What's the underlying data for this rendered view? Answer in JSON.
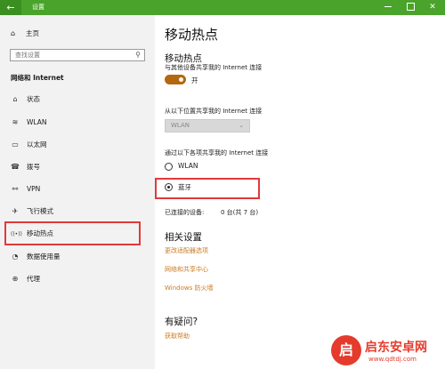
{
  "titlebar": {
    "title": "设置",
    "back_icon": "←",
    "close_icon": "✕"
  },
  "sidebar": {
    "home_label": "主页",
    "search_placeholder": "查找设置",
    "section_title": "网络和 Internet",
    "items": [
      {
        "label": "状态",
        "icon": "⌂"
      },
      {
        "label": "WLAN",
        "icon": "≋"
      },
      {
        "label": "以太网",
        "icon": "▭"
      },
      {
        "label": "拨号",
        "icon": "☎"
      },
      {
        "label": "VPN",
        "icon": "⚯"
      },
      {
        "label": "飞行模式",
        "icon": "✈"
      },
      {
        "label": "移动热点",
        "icon": "((•))"
      },
      {
        "label": "数据使用量",
        "icon": "◔"
      },
      {
        "label": "代理",
        "icon": "⊕"
      }
    ]
  },
  "main": {
    "page_title": "移动热点",
    "hotspot_heading": "移动热点",
    "share_desc": "与其他设备共享我的 Internet 连接",
    "toggle_state": "开",
    "share_from_label": "从以下位置共享我的 Internet 连接",
    "share_from_value": "WLAN",
    "share_over_label": "通过以下各项共享我的 Internet 连接",
    "options": [
      {
        "label": "WLAN",
        "selected": false
      },
      {
        "label": "蓝牙",
        "selected": true
      }
    ],
    "connected_label": "已连接的设备:",
    "connected_value": "0 台(共 7 台)",
    "related_heading": "相关设置",
    "related_links": [
      "更改适配器选项",
      "网络和共享中心",
      "Windows 防火墙"
    ],
    "question_heading": "有疑问?",
    "help_link": "获取帮助"
  },
  "watermark": {
    "logo_char": "启",
    "title": "启东安卓网",
    "url": "www.qdtdj.com"
  },
  "colors": {
    "titlebar": "#4aa32a",
    "accent": "#cb7b20",
    "toggle": "#b5670f",
    "highlight": "#e03a3a"
  }
}
